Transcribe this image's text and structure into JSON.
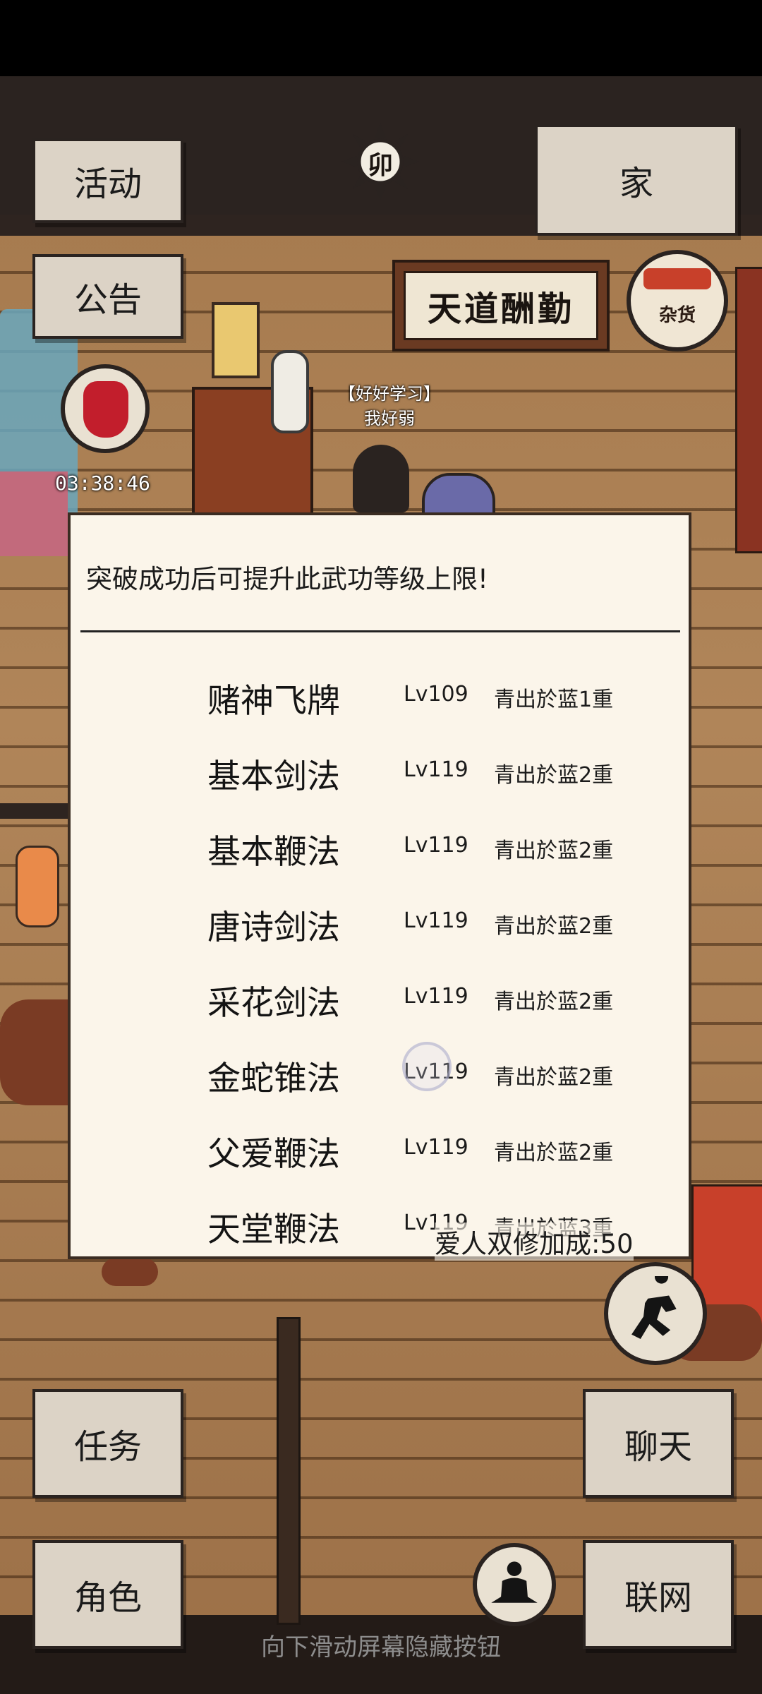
{
  "top_buttons": {
    "activity": "活动",
    "home": "家",
    "notice": "公告"
  },
  "sun_badge": "卯",
  "sign_text": "天道酬勤",
  "shop_label": "杂货",
  "timer": "03:38:46",
  "player": {
    "guild": "【好好学习】",
    "name": "我好弱"
  },
  "dialog": {
    "title": "突破成功后可提升此武功等级上限!",
    "skills": [
      {
        "name": "赌神飞牌",
        "level": "Lv109",
        "rank": "青出於蓝1重"
      },
      {
        "name": "基本剑法",
        "level": "Lv119",
        "rank": "青出於蓝2重"
      },
      {
        "name": "基本鞭法",
        "level": "Lv119",
        "rank": "青出於蓝2重"
      },
      {
        "name": "唐诗剑法",
        "level": "Lv119",
        "rank": "青出於蓝2重"
      },
      {
        "name": "采花剑法",
        "level": "Lv119",
        "rank": "青出於蓝2重"
      },
      {
        "name": "金蛇锥法",
        "level": "Lv119",
        "rank": "青出於蓝2重"
      },
      {
        "name": "父爱鞭法",
        "level": "Lv119",
        "rank": "青出於蓝2重"
      },
      {
        "name": "天堂鞭法",
        "level": "Lv119",
        "rank": "青出於蓝3重"
      }
    ]
  },
  "bonus_text": "爱人双修加成:50",
  "bottom_buttons": {
    "quest": "任务",
    "chat": "聊天",
    "character": "角色",
    "network": "联网"
  },
  "hint_text": "向下滑动屏幕隐藏按钮",
  "colors": {
    "dialog_bg": "#fbf5ea",
    "button_bg": "#dcd3c6",
    "wood": "#a4784c"
  }
}
